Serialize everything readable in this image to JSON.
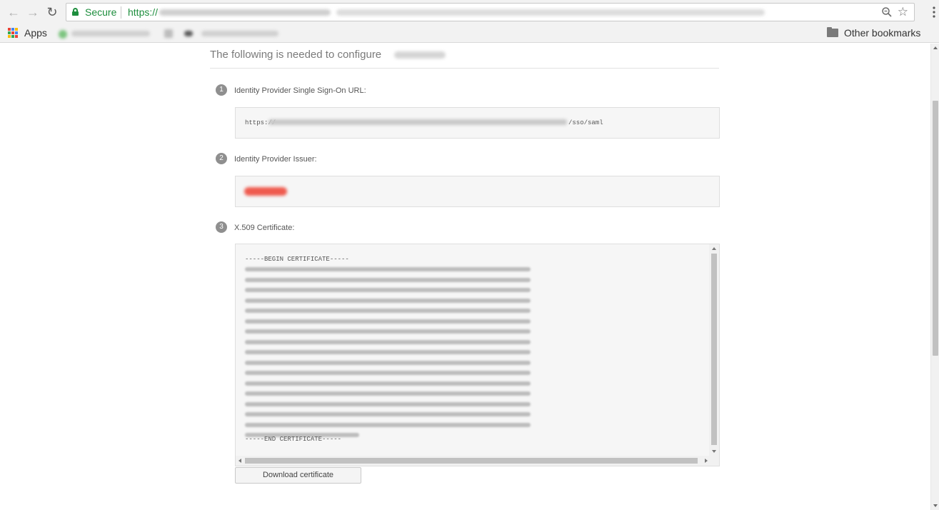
{
  "browser": {
    "secure_label": "Secure",
    "url_scheme": "https://",
    "nav": {
      "back_icon": "arrow-left-icon",
      "forward_icon": "arrow-right-icon",
      "reload_icon": "reload-icon"
    },
    "bookmarks": {
      "apps_label": "Apps",
      "other_bookmarks_label": "Other bookmarks"
    }
  },
  "page": {
    "heading": "The following is needed to configure",
    "steps": [
      {
        "number": "1",
        "label": "Identity Provider Single Sign-On URL:"
      },
      {
        "number": "2",
        "label": "Identity Provider Issuer:"
      },
      {
        "number": "3",
        "label": "X.509 Certificate:"
      }
    ],
    "sso_url": {
      "prefix": "https://",
      "suffix": "/sso/saml"
    },
    "certificate": {
      "begin": "-----BEGIN CERTIFICATE-----",
      "end": "-----END CERTIFICATE-----"
    },
    "download_button_label": "Download certificate"
  },
  "colors": {
    "secure_green": "#1e8e3e",
    "step_badge": "#8f8f8f",
    "redacted": "#ef5b4f"
  }
}
